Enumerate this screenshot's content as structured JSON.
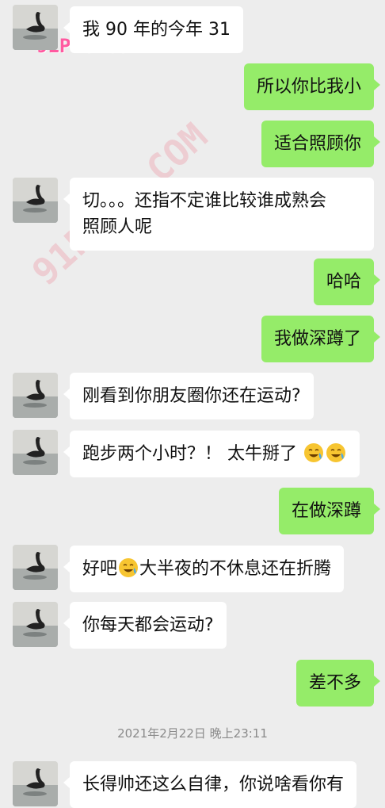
{
  "watermarks": [
    "91P46.COM",
    "91PORN.COM"
  ],
  "messages": [
    {
      "side": "left",
      "text": "我 90 年的今年 31"
    },
    {
      "side": "right",
      "text": "所以你比我小"
    },
    {
      "side": "right",
      "text": "适合照顾你"
    },
    {
      "side": "left",
      "line1": "切。。。还指不定谁比较谁成熟会",
      "line2": "照顾人呢"
    },
    {
      "side": "right",
      "text": "哈哈"
    },
    {
      "side": "right",
      "text": "我做深蹲了"
    },
    {
      "side": "left",
      "text": "刚看到你朋友圈你还在运动?"
    },
    {
      "side": "left",
      "text": "跑步两个小时？！ 太牛掰了"
    },
    {
      "side": "right",
      "text": "在做深蹲"
    },
    {
      "side": "left",
      "pre": "好吧",
      "post": "大半夜的不休息还在折腾"
    },
    {
      "side": "left",
      "text": "你每天都会运动?"
    },
    {
      "side": "right",
      "text": "差不多"
    },
    {
      "side": "left",
      "text": "长得帅还这么自律，你说啥看你有"
    }
  ],
  "timestamp": "2021年2月22日 晚上23:11",
  "emoji_name": "laugh-cry-emoji",
  "colors": {
    "background": "#ededed",
    "self_bubble": "#95ec69",
    "other_bubble": "#ffffff"
  }
}
